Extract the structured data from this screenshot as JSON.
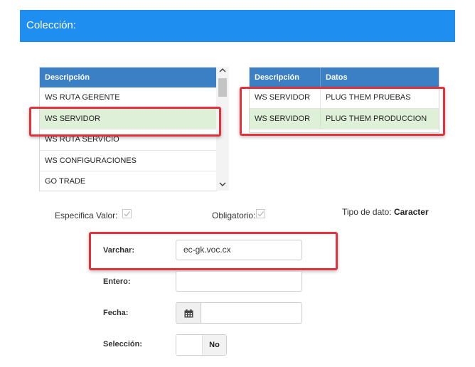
{
  "header": {
    "title": "Colección:"
  },
  "left_table": {
    "header": "Descripción",
    "rows": [
      {
        "label": "WS RUTA GERENTE",
        "selected": false
      },
      {
        "label": "WS SERVIDOR",
        "selected": true
      },
      {
        "label": "WS RUTA SERVICIO",
        "selected": false
      },
      {
        "label": "WS CONFIGURACIONES",
        "selected": false
      },
      {
        "label": "GO TRADE",
        "selected": false
      }
    ]
  },
  "right_table": {
    "headers": [
      "Descripción",
      "Datos"
    ],
    "rows": [
      {
        "descripcion": "WS SERVIDOR",
        "datos": "PLUG THEM PRUEBAS"
      },
      {
        "descripcion": "WS SERVIDOR",
        "datos": "PLUG THEM PRODUCCION"
      }
    ]
  },
  "options": {
    "especifica_label": "Especifica Valor:",
    "obligatorio_label": "Obligatorio:",
    "tipo_label": "Tipo de dato:",
    "tipo_value": "Caracter"
  },
  "form": {
    "varchar_label": "Varchar:",
    "varchar_value": "ec-gk.voc.cx",
    "entero_label": "Entero:",
    "entero_value": "",
    "fecha_label": "Fecha:",
    "seleccion_label": "Selección:",
    "seleccion_value": "No"
  },
  "colors": {
    "header_bg": "#1f8ef1",
    "table_header_bg": "#3b7fc4",
    "selected_row_bg": "#dff0d8",
    "highlight_border": "#e3323b"
  }
}
